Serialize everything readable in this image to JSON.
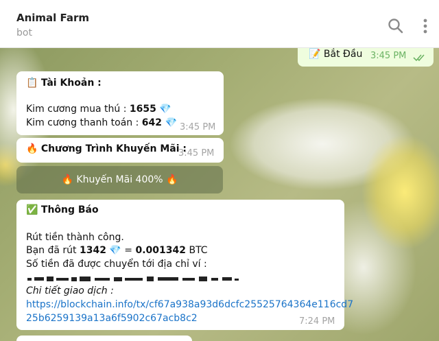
{
  "header": {
    "title": "Animal Farm",
    "subtitle": "bot",
    "search_icon": "search-icon",
    "more_icon": "more-vertical-icon"
  },
  "outgoing": {
    "icon": "memo-icon",
    "text": "Bắt Đầu",
    "time": "3:45 PM",
    "status": "read-double-check-icon"
  },
  "account": {
    "icon": "clipboard-icon",
    "title": "Tài Khoản :",
    "line1_label": "Kim cương mua thú : ",
    "line1_value": "1655",
    "line2_label": "Kim cương thanh toán : ",
    "line2_value": "642",
    "gem_icon": "gem-icon",
    "time": "3:45 PM"
  },
  "promo": {
    "icon": "fire-icon",
    "title": "Chương Trình Khuyến Mãi :",
    "time": "3:45 PM",
    "button_label": "Khuyến Mãi 400%"
  },
  "notice": {
    "icon": "check-box-icon",
    "title": "Thông Báo",
    "line1": "Rút tiền thành công.",
    "line2_prefix": "Bạn đã rút  ",
    "line2_amount": "1342",
    "line2_eq": " = ",
    "line2_btc": "0.001342",
    "line2_unit": " BTC",
    "line3": "Số tiền đã được chuyển tới địa chỉ ví :",
    "line5": "Chi tiết giao dịch :",
    "link_line1": "https://blockchain.info/tx/cf67a938a93d6dcfc25525764364e116cd7",
    "link_line2": "25b6259139a13a6f5902c67acb8c2",
    "time": "7:24 PM"
  },
  "colors": {
    "outgoing_bubble": "#effdde",
    "link": "#1a73c8",
    "read_ticks": "#6cb364",
    "gem": "#3aa0e8"
  }
}
